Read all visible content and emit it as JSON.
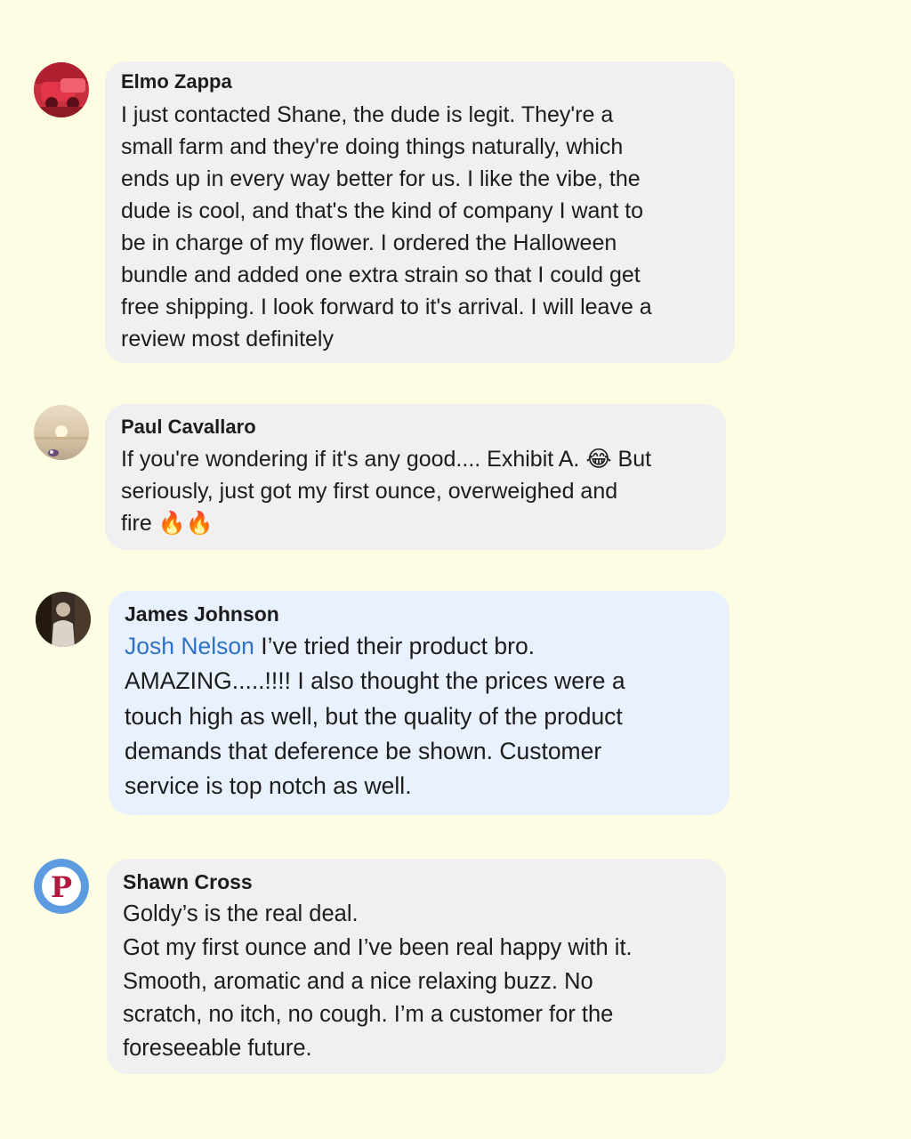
{
  "colors": {
    "page_background": "#fdfde3",
    "bubble_grey": "#f0f0f1",
    "bubble_highlight": "#e8f1fd",
    "mention_link": "#2d72c8"
  },
  "comments": [
    {
      "author": "Elmo Zappa",
      "avatar_icon": "red-car-avatar",
      "text": "I just contacted Shane, the dude is legit. They're a\nsmall farm and they're doing things naturally, which\nends up in every way better for us. I like the vibe, the\ndude is cool, and that's the kind of company I want to\nbe in charge of my flower. I ordered the Halloween\nbundle and added one extra strain so that I could get\nfree shipping. I look forward to it's arrival. I will leave a\nreview most definitely"
    },
    {
      "author": "Paul Cavallaro",
      "avatar_icon": "sunset-beach-avatar",
      "text_before_emoji": "If you're wondering if it's any good.... Exhibit A.",
      "emoji_1": "😂",
      "text_after_emoji": "But\nseriously, just got my first ounce, overweighed and\nfire",
      "emoji_2": "🔥🔥"
    },
    {
      "author": "James Johnson",
      "avatar_icon": "person-photo-avatar",
      "mention": "Josh Nelson",
      "text": "I’ve tried their product bro.\nAMAZING.....!!!! I also thought the prices were a\ntouch high as well, but the quality of the product\ndemands that deference be shown. Customer\nservice is top notch as well."
    },
    {
      "author": "Shawn Cross",
      "avatar_icon": "letter-p-logo-avatar",
      "avatar_letter": "P",
      "text": "Goldy’s is the real deal.\nGot my first ounce and I’ve been real happy with it.\nSmooth, aromatic and a nice relaxing buzz. No\nscratch, no itch, no cough. I’m a customer for the\nforeseeable future."
    }
  ]
}
